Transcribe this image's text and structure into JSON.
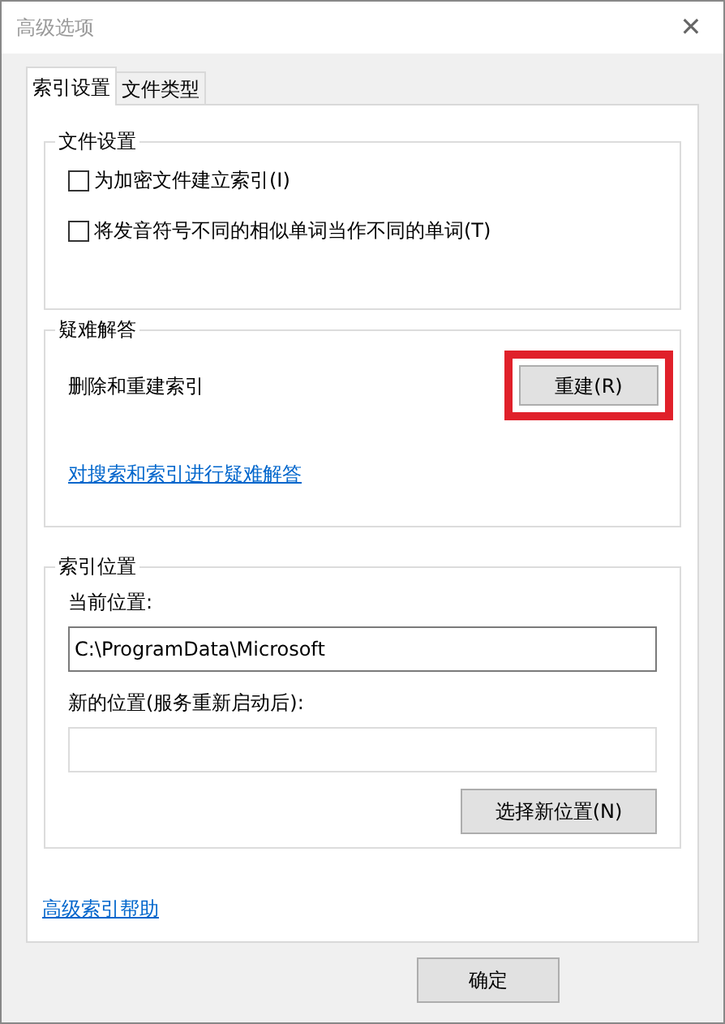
{
  "window": {
    "title": "高级选项",
    "close": "✕"
  },
  "tabs": [
    {
      "label": "索引设置",
      "selected": true
    },
    {
      "label": "文件类型",
      "selected": false
    }
  ],
  "file_settings": {
    "title": "文件设置",
    "options": [
      {
        "label": "为加密文件建立索引(I)",
        "checked": false
      },
      {
        "label": "将发音符号不同的相似单词当作不同的单词(T)",
        "checked": false
      }
    ]
  },
  "troubleshooting": {
    "title": "疑难解答",
    "description": "删除和重建索引",
    "button": {
      "label": "重建(R)",
      "highlighted": true
    },
    "link": "对搜索和索引进行疑难解答"
  },
  "index_location": {
    "title": "索引位置",
    "current_label": "当前位置:",
    "current_value": "C:\\ProgramData\\Microsoft",
    "new_label": "新的位置(服务重新启动后):",
    "button": "选择新位置(N)"
  },
  "help_link": "高级索引帮助",
  "buttons": [
    "确定"
  ]
}
